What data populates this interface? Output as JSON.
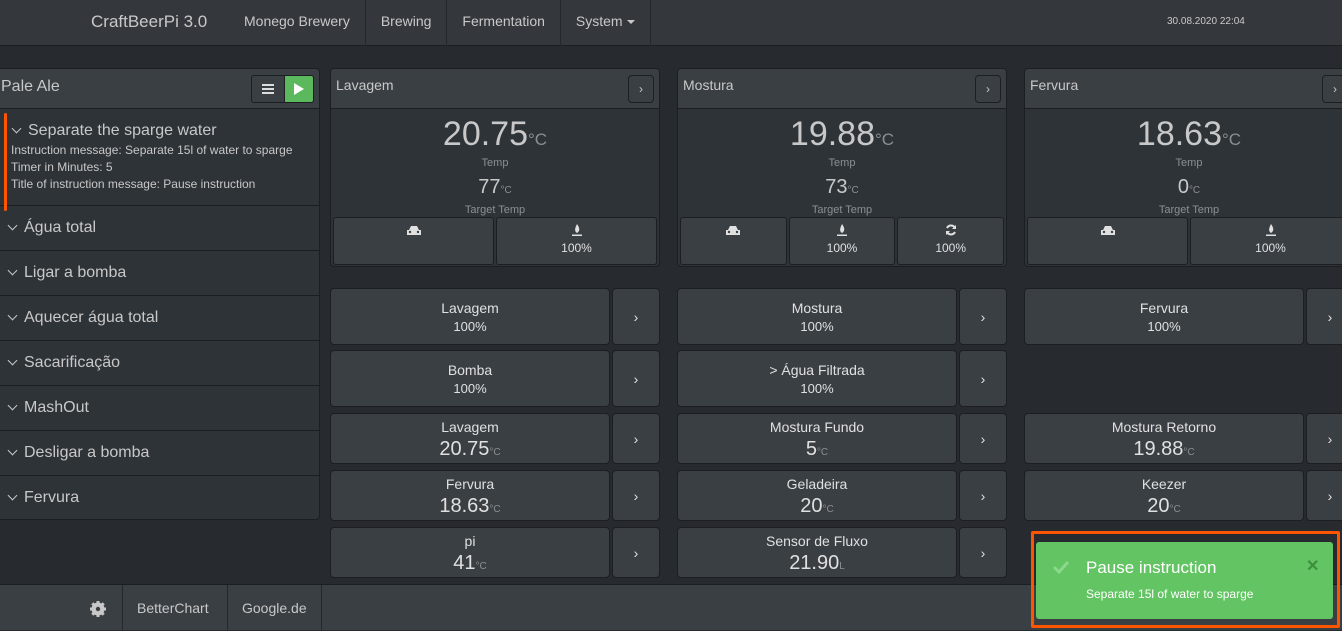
{
  "nav": {
    "brand": "CraftBeerPi 3.0",
    "items": [
      "Monego Brewery",
      "Brewing",
      "Fermentation",
      "System"
    ],
    "datetime": "30.08.2020 22:04"
  },
  "brew": {
    "title": "Pale Ale",
    "active_step": {
      "name": "Separate the sparge water",
      "details": [
        "Instruction message: Separate 15l of water to sparge",
        "Timer in Minutes: 5",
        "Title of instruction message: Pause instruction"
      ]
    },
    "steps": [
      "Água total",
      "Ligar a bomba",
      "Aquecer água total",
      "Sacarificação",
      "MashOut",
      "Desligar a bomba",
      "Fervura"
    ]
  },
  "kettles": [
    {
      "name": "Lavagem",
      "temp": "20.75",
      "unit": "°C",
      "temp_label": "Temp",
      "target": "77",
      "target_label": "Target Temp",
      "buttons": [
        {
          "icon": "car-icon",
          "value": ""
        },
        {
          "icon": "fire-icon",
          "value": "100%"
        }
      ]
    },
    {
      "name": "Mostura",
      "temp": "19.88",
      "unit": "°C",
      "temp_label": "Temp",
      "target": "73",
      "target_label": "Target Temp",
      "buttons": [
        {
          "icon": "car-icon",
          "value": ""
        },
        {
          "icon": "fire-icon",
          "value": "100%"
        },
        {
          "icon": "refresh-icon",
          "value": "100%"
        }
      ]
    },
    {
      "name": "Fervura",
      "temp": "18.63",
      "unit": "°C",
      "temp_label": "Temp",
      "target": "0",
      "target_label": "Target Temp",
      "buttons": [
        {
          "icon": "car-icon",
          "value": ""
        },
        {
          "icon": "fire-icon",
          "value": "100%"
        }
      ]
    }
  ],
  "actors": [
    {
      "name": "Lavagem",
      "value": "100%"
    },
    {
      "name": "Mostura",
      "value": "100%"
    },
    {
      "name": "Fervura",
      "value": "100%"
    },
    {
      "name": "Bomba",
      "value": "100%"
    },
    {
      "name": "> Água Filtrada",
      "value": "100%"
    }
  ],
  "sensors": [
    {
      "name": "Lavagem",
      "value": "20.75",
      "unit": "°C"
    },
    {
      "name": "Mostura Fundo",
      "value": "5",
      "unit": "°C"
    },
    {
      "name": "Mostura Retorno",
      "value": "19.88",
      "unit": "°C"
    },
    {
      "name": "Fervura",
      "value": "18.63",
      "unit": "°C"
    },
    {
      "name": "Geladeira",
      "value": "20",
      "unit": "°C"
    },
    {
      "name": "Keezer",
      "value": "20",
      "unit": "°C"
    },
    {
      "name": "pi",
      "value": "41",
      "unit": "°C"
    },
    {
      "name": "Sensor de Fluxo",
      "value": "21.90",
      "unit": "L"
    }
  ],
  "footer": {
    "links": [
      "BetterChart",
      "Google.de"
    ]
  },
  "toast": {
    "title": "Pause instruction",
    "message": "Separate 15l of water to sparge",
    "color": "#62c462"
  },
  "colors": {
    "accent_green": "#5cb85c",
    "active_step_marker": "#ff5500"
  }
}
